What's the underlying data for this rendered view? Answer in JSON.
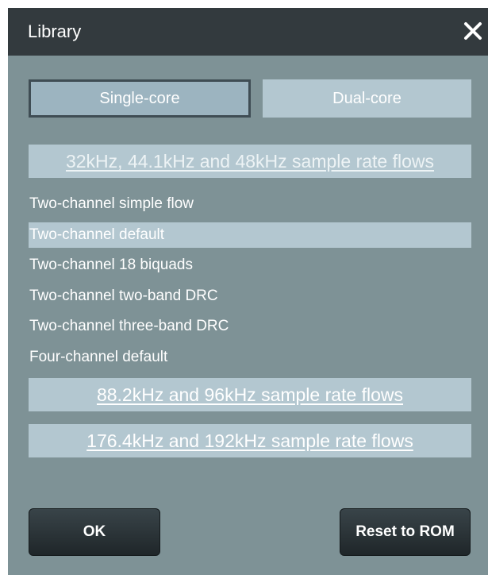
{
  "dialog": {
    "title": "Library",
    "close_icon": "close-icon"
  },
  "tabs": {
    "single_label": "Single-core",
    "dual_label": "Dual-core",
    "selected": "Single-core"
  },
  "sections": [
    {
      "label": "32kHz, 44.1kHz and 48kHz sample rate flows",
      "expanded": true,
      "items": [
        {
          "label": "Two-channel simple flow",
          "selected": false
        },
        {
          "label": "Two-channel default",
          "selected": true
        },
        {
          "label": "Two-channel 18 biquads",
          "selected": false
        },
        {
          "label": "Two-channel two-band DRC",
          "selected": false
        },
        {
          "label": "Two-channel three-band DRC",
          "selected": false
        },
        {
          "label": "Four-channel default",
          "selected": false
        }
      ]
    },
    {
      "label": "88.2kHz and 96kHz sample rate flows",
      "expanded": false
    },
    {
      "label": "176.4kHz and 192kHz sample rate flows",
      "expanded": false
    }
  ],
  "buttons": {
    "ok_label": "OK",
    "reset_label": "Reset to ROM"
  },
  "colors": {
    "titlebar": "#333a3e",
    "background": "#7e9296",
    "highlight": "#b3c7d0",
    "button": "#262e32"
  }
}
